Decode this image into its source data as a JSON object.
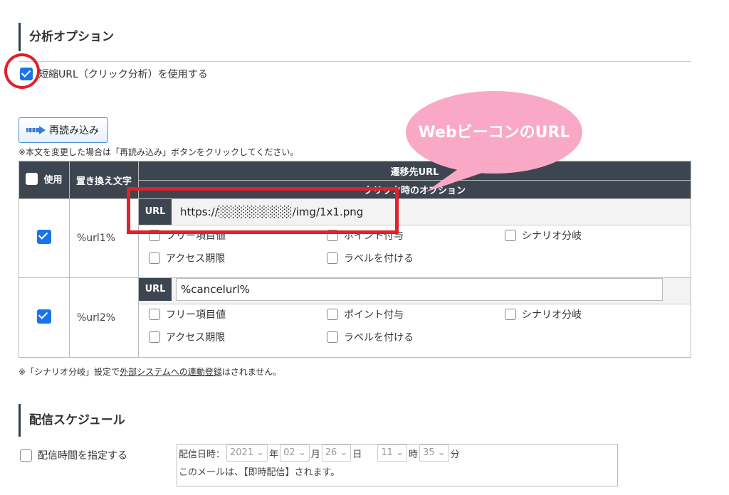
{
  "analysis": {
    "heading": "分析オプション",
    "short_url_label": "短縮URL（クリック分析）を使用する",
    "short_url_checked": true,
    "reload_button": "再読み込み",
    "reload_note": "※本文を変更した場合は「再読み込み」ボタンをクリックしてください。",
    "callout": "WebビーコンのURL"
  },
  "table": {
    "col_use": "使用",
    "col_replace": "置き換え文字",
    "col_dest": "遷移先URL",
    "col_click_opts": "クリック時のオプション",
    "url_label": "URL",
    "rows": [
      {
        "checked": true,
        "replace": "%url1%",
        "url_value": "https://░░░░░░░░░/img/1x1.png"
      },
      {
        "checked": true,
        "replace": "%url2%",
        "url_value": "%cancelurl%"
      }
    ],
    "options": [
      "フリー項目値",
      "ポイント付与",
      "シナリオ分岐",
      "アクセス期限",
      "ラベルを付ける"
    ]
  },
  "scenario_note": {
    "prefix": "※「シナリオ分岐」設定で",
    "link": "外部システムへの連動登録",
    "suffix": "はされません。"
  },
  "schedule": {
    "heading": "配信スケジュール",
    "specify_time_label": "配信時間を指定する",
    "datetime_label": "配信日時：",
    "year": "2021",
    "year_unit": "年",
    "month": "02",
    "month_unit": "月",
    "day": "26",
    "day_unit": "日",
    "hour": "11",
    "hour_unit": "時",
    "minute": "35",
    "minute_unit": "分",
    "status": "このメールは、【即時配信】されます。"
  }
}
